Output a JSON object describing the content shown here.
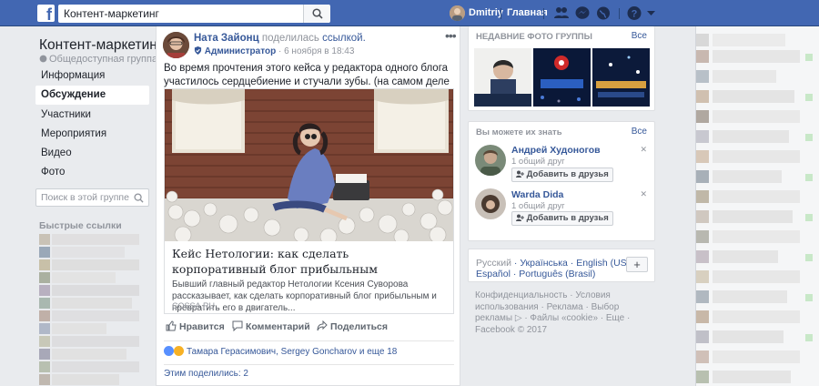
{
  "topbar": {
    "search_value": "Контент-маркетинг",
    "user_name": "Dmitriy",
    "home_label": "Главная",
    "colors": {
      "bar": "#4267b2"
    }
  },
  "left": {
    "group_title": "Контент-маркетинг",
    "group_sub": "Общедоступная группа",
    "nav": [
      "Информация",
      "Обсуждение",
      "Участники",
      "Мероприятия",
      "Видео",
      "Фото"
    ],
    "active_nav": "Обсуждение",
    "search_placeholder": "Поиск в этой группе",
    "quick_links": "Быстрые ссылки"
  },
  "post": {
    "author": "Ната Зайонц",
    "shared_text": "поделилась",
    "shared_link": "ссылкой.",
    "role": "Администратор",
    "date": "6 ноября в 18:43",
    "text": "Во время прочтения этого кейса у редактора одного блога участилось сердцебиение и стучали зубы. (на самом деле хо ро шо)",
    "link_title": "Кейс Нетологии: как сделать корпоративный блог прибыльным",
    "link_desc": "Бывший главный редактор Нетологии Ксения Суворова рассказывает, как сделать корпоративный блог прибыльным и превратить его в двигатель...",
    "link_source": "COSSA.RU",
    "like": "Нравится",
    "comment": "Комментарий",
    "share": "Поделиться",
    "reactions": "Тамара Герасимович, Sergey Goncharov и еще 18",
    "shared_count": "Этим поделились: 2"
  },
  "photos": {
    "header": "НЕДАВНИЕ ФОТО ГРУППЫ",
    "all": "Все"
  },
  "pymk": {
    "header": "Вы можете их знать",
    "all": "Все",
    "people": [
      {
        "name": "Андрей Худоногов",
        "mutual": "1 общий друг",
        "button": "Добавить в друзья"
      },
      {
        "name": "Warda Dida",
        "mutual": "1 общий друг",
        "button": "Добавить в друзья"
      }
    ]
  },
  "languages": {
    "row1": [
      "Русский",
      "Українська",
      "English (US)"
    ],
    "row2": [
      "Español",
      "Português (Brasil)"
    ]
  },
  "footer": "Конфиденциальность · Условия использования · Реклама · Выбор рекламы ▷ · Файлы «cookie» · Еще · Facebook © 2017"
}
